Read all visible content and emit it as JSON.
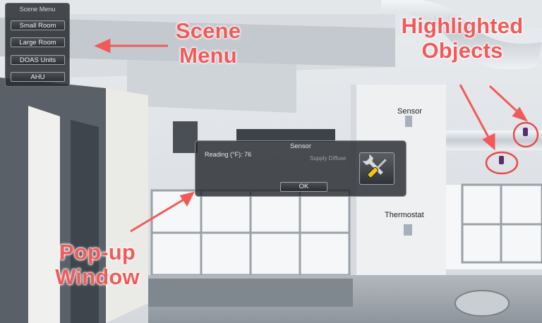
{
  "scene_menu": {
    "title": "Scene Menu",
    "buttons": [
      "Small Room",
      "Large Room",
      "DOAS Units",
      "AHU"
    ]
  },
  "popup": {
    "title": "Sensor",
    "reading": "Reading (°F): 76",
    "faint_text": "Supply Diffuse",
    "ok_label": "OK",
    "icon": "wrench-screwdriver-icon"
  },
  "scene_labels": {
    "sensor": "Sensor",
    "thermostat": "Thermostat"
  },
  "annotations": {
    "scene_menu": [
      "Scene",
      "Menu"
    ],
    "highlighted_objects": [
      "Highlighted",
      "Objects"
    ],
    "popup_window": [
      "Pop-up",
      "Window"
    ]
  },
  "colors": {
    "annotation": "#f25a5a",
    "panel_bg": "#2a2e32"
  }
}
